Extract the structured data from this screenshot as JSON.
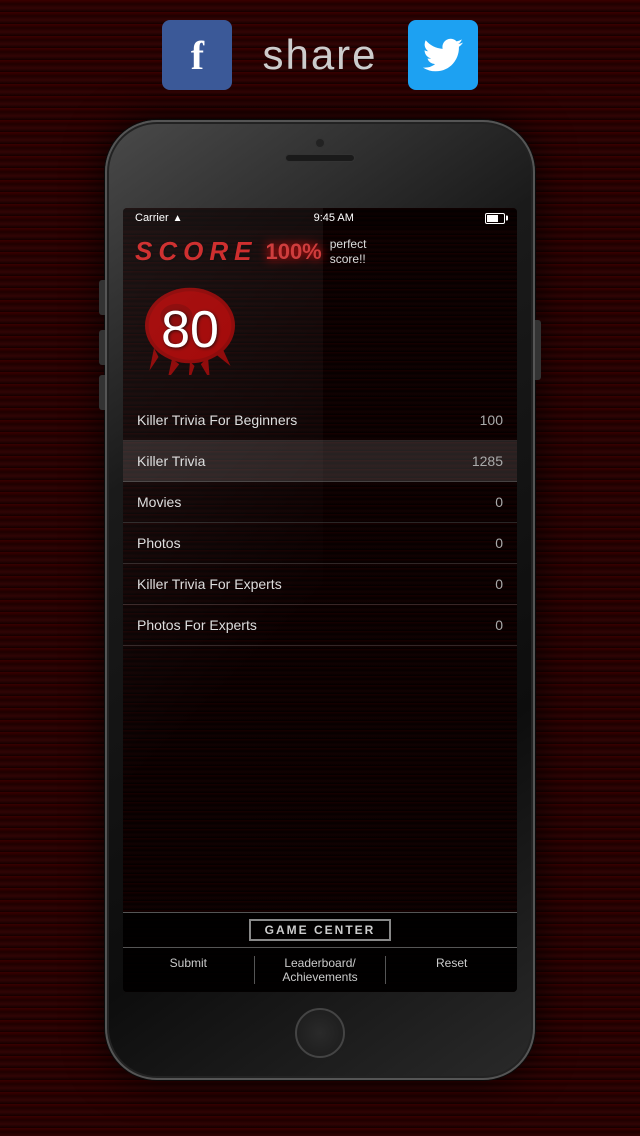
{
  "background": {
    "color": "#1a0000"
  },
  "share_bar": {
    "facebook_label": "f",
    "share_text": "share",
    "twitter_label": "twitter"
  },
  "phone": {
    "status_bar": {
      "carrier": "Carrier",
      "wifi": "wifi",
      "time": "9:45 AM"
    },
    "score_display": {
      "score_label": "SCORE",
      "percent": "100%",
      "perfect_line1": "perfect",
      "perfect_line2": "score!!",
      "number": "80"
    },
    "list_items": [
      {
        "name": "Killer Trivia For Beginners",
        "score": "100",
        "highlighted": false
      },
      {
        "name": "Killer Trivia",
        "score": "1285",
        "highlighted": true
      },
      {
        "name": "Movies",
        "score": "0",
        "highlighted": false
      },
      {
        "name": "Photos",
        "score": "0",
        "highlighted": false
      },
      {
        "name": "Killer Trivia For Experts",
        "score": "0",
        "highlighted": false
      },
      {
        "name": "Photos For Experts",
        "score": "0",
        "highlighted": false
      }
    ],
    "game_center": {
      "title": "GAME CENTER",
      "submit": "Submit",
      "leaderboard": "Leaderboard/\nAchievements",
      "reset": "Reset"
    }
  }
}
